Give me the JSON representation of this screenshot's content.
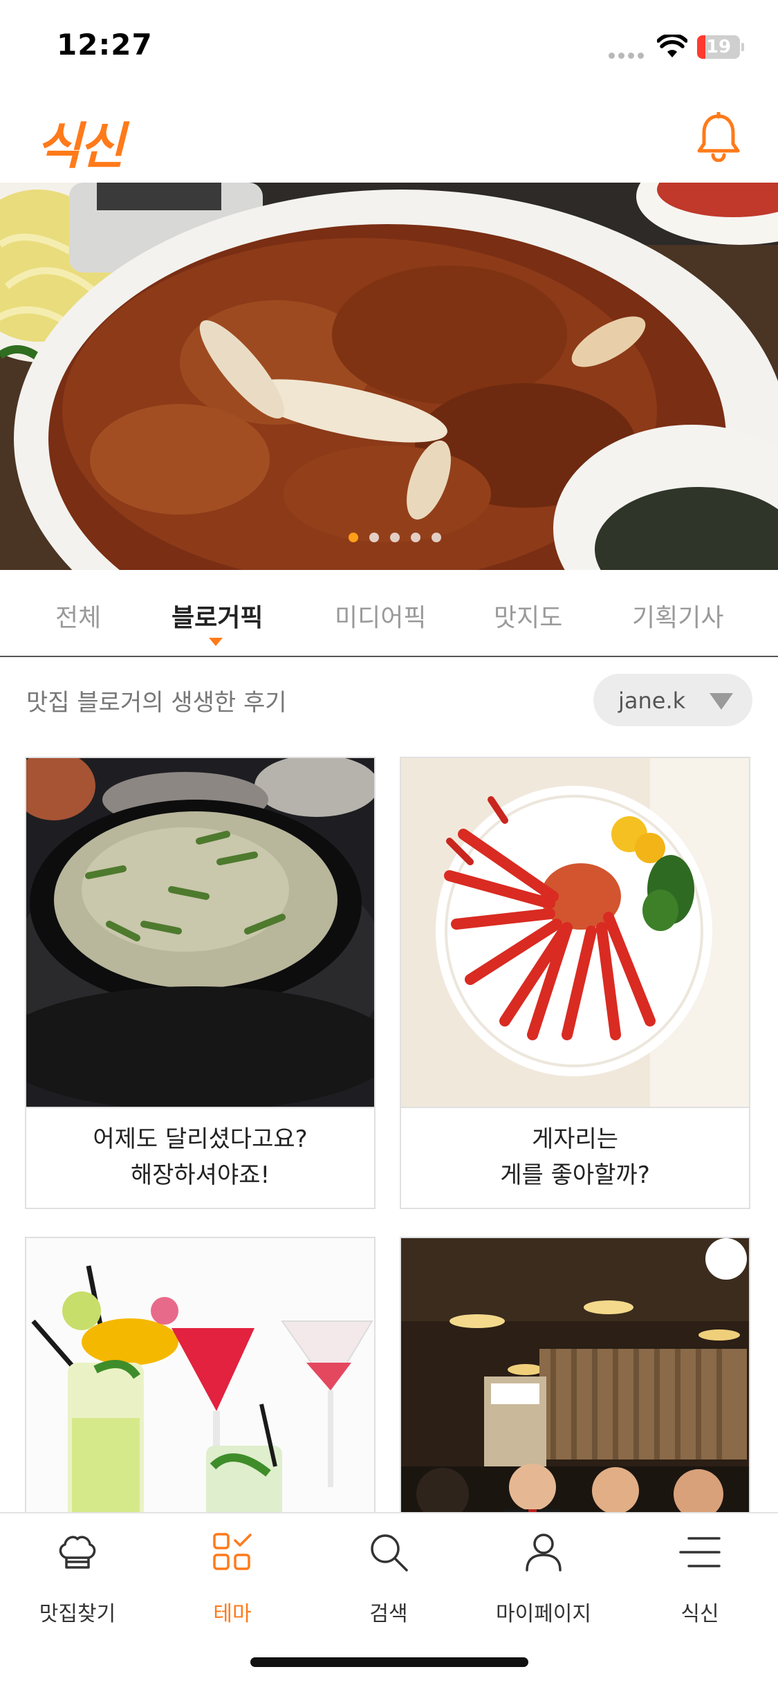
{
  "status_bar": {
    "time": "12:27",
    "battery": "19",
    "battery_level": 0.19
  },
  "header": {
    "logo": "식신",
    "bell_icon": "bell-icon"
  },
  "hero": {
    "page_count": 5,
    "active_page": 0
  },
  "tabs": [
    {
      "label": "전체",
      "active": false
    },
    {
      "label": "블로거픽",
      "active": true
    },
    {
      "label": "미디어픽",
      "active": false
    },
    {
      "label": "맛지도",
      "active": false
    },
    {
      "label": "기획기사",
      "active": false
    }
  ],
  "subheader": {
    "text": "맛집 블로거의 생생한 후기",
    "selected_user": "jane.k"
  },
  "cards": [
    {
      "line1": "어제도 달리셨다고요?",
      "line2": "해장하셔야죠!"
    },
    {
      "line1": "게자리는",
      "line2": "게를 좋아할까?"
    },
    {
      "line1": "",
      "line2": ""
    },
    {
      "line1": "",
      "line2": ""
    }
  ],
  "bottom_nav": [
    {
      "label": "맛집찾기",
      "icon": "chef-hat-icon",
      "active": false
    },
    {
      "label": "테마",
      "icon": "theme-grid-icon",
      "active": true
    },
    {
      "label": "검색",
      "icon": "search-icon",
      "active": false
    },
    {
      "label": "마이페이지",
      "icon": "person-icon",
      "active": false
    },
    {
      "label": "식신",
      "icon": "menu-icon",
      "active": false
    }
  ],
  "colors": {
    "accent": "#ff7a1a",
    "battery_low": "#ff3b30"
  }
}
